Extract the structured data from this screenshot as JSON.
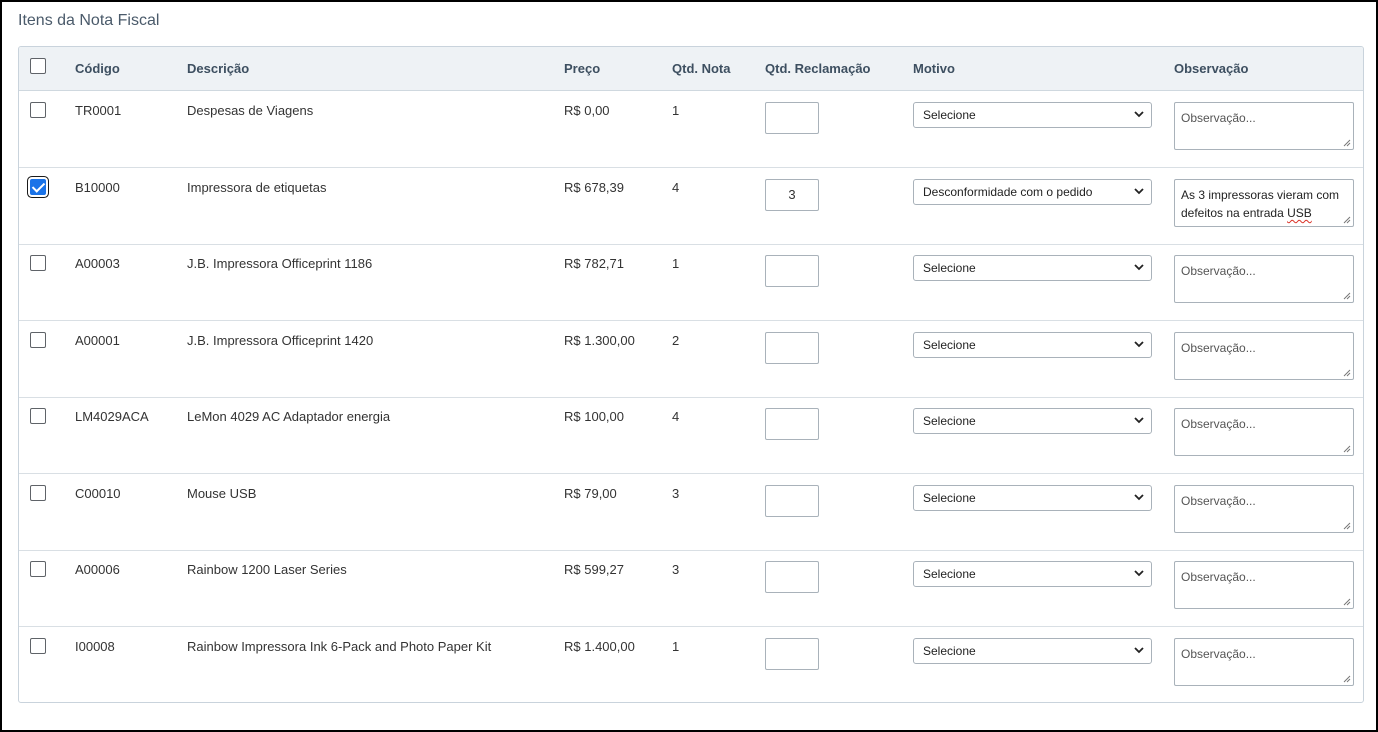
{
  "section": {
    "title": "Itens da Nota Fiscal"
  },
  "table": {
    "headers": {
      "codigo": "Código",
      "descricao": "Descrição",
      "preco": "Preço",
      "qtd_nota": "Qtd. Nota",
      "qtd_reclamacao": "Qtd. Reclamação",
      "motivo": "Motivo",
      "observacao": "Observação"
    },
    "select_all_checked": false,
    "rows": [
      {
        "checked": false,
        "codigo": "TR0001",
        "descricao": "Despesas de Viagens",
        "preco": "R$ 0,00",
        "qtd_nota": "1",
        "qtd_reclamacao": "",
        "motivo": "Selecione",
        "observacao_value": "",
        "observacao_placeholder": "Observação..."
      },
      {
        "checked": true,
        "codigo": "B10000",
        "descricao": "Impressora de etiquetas",
        "preco": "R$ 678,39",
        "qtd_nota": "4",
        "qtd_reclamacao": "3",
        "motivo": "Desconformidade com o pedido",
        "observacao_value": "As 3 impressoras vieram com defeitos na entrada USB",
        "observacao_placeholder": "Observação..."
      },
      {
        "checked": false,
        "codigo": "A00003",
        "descricao": "J.B. Impressora Officeprint 1186",
        "preco": "R$ 782,71",
        "qtd_nota": "1",
        "qtd_reclamacao": "",
        "motivo": "Selecione",
        "observacao_value": "",
        "observacao_placeholder": "Observação..."
      },
      {
        "checked": false,
        "codigo": "A00001",
        "descricao": "J.B. Impressora Officeprint 1420",
        "preco": "R$ 1.300,00",
        "qtd_nota": "2",
        "qtd_reclamacao": "",
        "motivo": "Selecione",
        "observacao_value": "",
        "observacao_placeholder": "Observação..."
      },
      {
        "checked": false,
        "codigo": "LM4029ACA",
        "descricao": "LeMon 4029 AC Adaptador energia",
        "preco": "R$ 100,00",
        "qtd_nota": "4",
        "qtd_reclamacao": "",
        "motivo": "Selecione",
        "observacao_value": "",
        "observacao_placeholder": "Observação..."
      },
      {
        "checked": false,
        "codigo": "C00010",
        "descricao": "Mouse USB",
        "preco": "R$ 79,00",
        "qtd_nota": "3",
        "qtd_reclamacao": "",
        "motivo": "Selecione",
        "observacao_value": "",
        "observacao_placeholder": "Observação..."
      },
      {
        "checked": false,
        "codigo": "A00006",
        "descricao": "Rainbow 1200 Laser Series",
        "preco": "R$ 599,27",
        "qtd_nota": "3",
        "qtd_reclamacao": "",
        "motivo": "Selecione",
        "observacao_value": "",
        "observacao_placeholder": "Observação..."
      },
      {
        "checked": false,
        "codigo": "I00008",
        "descricao": "Rainbow Impressora Ink 6-Pack and Photo Paper Kit",
        "preco": "R$ 1.400,00",
        "qtd_nota": "1",
        "qtd_reclamacao": "",
        "motivo": "Selecione",
        "observacao_value": "",
        "observacao_placeholder": "Observação..."
      }
    ]
  },
  "icons": {
    "select_arrow": "chevron-down-icon",
    "resize_handle": "resize-grip-icon",
    "checkbox_mark": "checkmark-icon"
  },
  "colors": {
    "header_bg": "#eef2f5",
    "checkbox_checked": "#1a73e8",
    "spellcheck": "#d93025"
  }
}
